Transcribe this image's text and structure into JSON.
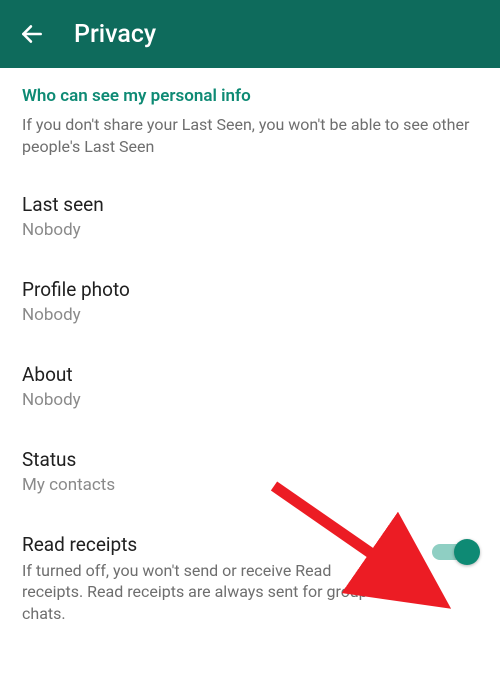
{
  "header": {
    "title": "Privacy"
  },
  "section": {
    "heading": "Who can see my personal info",
    "subtext": "If you don't share your Last Seen, you won't be able to see other people's Last Seen"
  },
  "settings": {
    "lastSeen": {
      "title": "Last seen",
      "value": "Nobody"
    },
    "profilePhoto": {
      "title": "Profile photo",
      "value": "Nobody"
    },
    "about": {
      "title": "About",
      "value": "Nobody"
    },
    "status": {
      "title": "Status",
      "value": "My contacts"
    },
    "readReceipts": {
      "title": "Read receipts",
      "desc": "If turned off, you won't send or receive Read receipts. Read receipts are always sent for group chats.",
      "enabled": true
    }
  },
  "colors": {
    "headerBg": "#0e6b5c",
    "accent": "#0e8a74",
    "arrow": "#ec1c24"
  }
}
